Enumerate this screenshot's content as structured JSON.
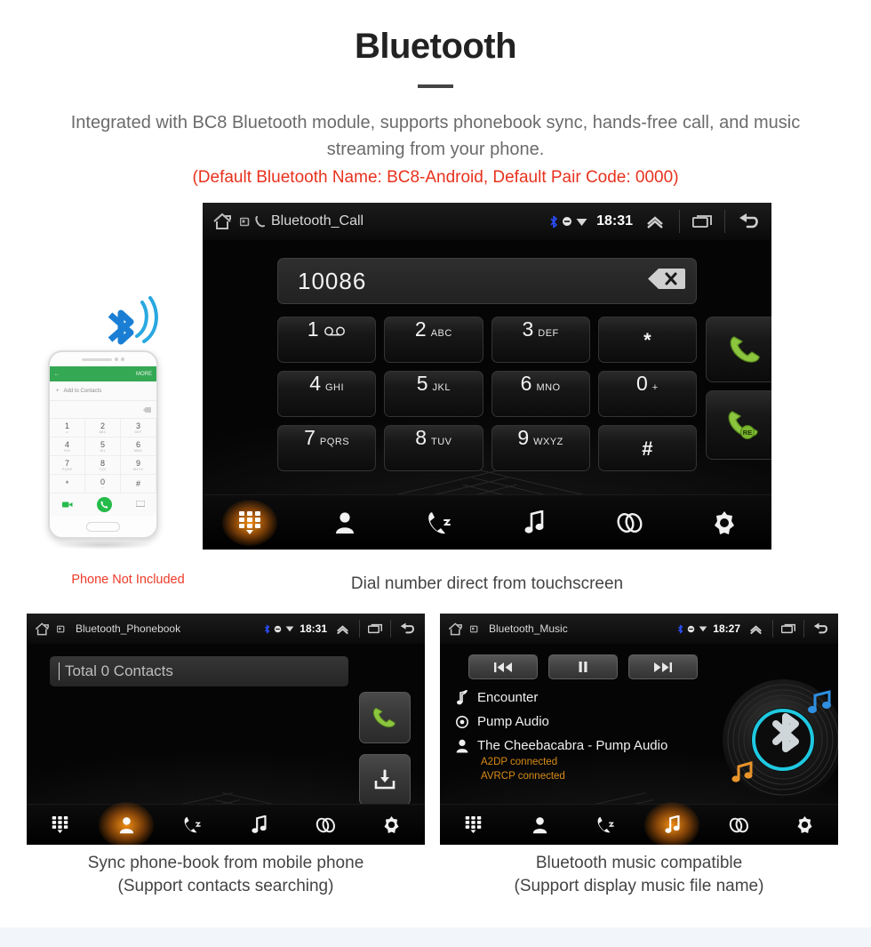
{
  "header": {
    "title": "Bluetooth",
    "subtitle": "Integrated with BC8 Bluetooth module, supports phonebook sync, hands-free call, and music streaming from your phone.",
    "note": "(Default Bluetooth Name: BC8-Android, Default Pair Code: 0000)",
    "note_color": "#e8321e"
  },
  "main_screen": {
    "statusbar": {
      "title": "Bluetooth_Call",
      "time": "18:31",
      "home_icon": "home-icon",
      "window_icon": "window-icon",
      "phone_icon": "phone-handset-icon",
      "bluetooth_icon": "bluetooth-icon",
      "mute_icon": "mute-circle-icon",
      "signal_icon": "signal-icon",
      "expand_icon": "chevron-up-icon",
      "recents_icon": "recents-icon",
      "back_icon": "back-arrow-icon",
      "bluetooth_color": "#2a4df5"
    },
    "dial_value": "10086",
    "backspace_icon": "backspace-icon",
    "keypad": [
      [
        {
          "digit": "1",
          "letters": "∞",
          "voicemail": true
        },
        {
          "digit": "2",
          "letters": "ABC"
        },
        {
          "digit": "3",
          "letters": "DEF"
        },
        {
          "digit": "*",
          "symbol": true
        }
      ],
      [
        {
          "digit": "4",
          "letters": "GHI"
        },
        {
          "digit": "5",
          "letters": "JKL"
        },
        {
          "digit": "6",
          "letters": "MNO"
        },
        {
          "digit": "0",
          "letters": "+"
        }
      ],
      [
        {
          "digit": "7",
          "letters": "PQRS"
        },
        {
          "digit": "8",
          "letters": "TUV"
        },
        {
          "digit": "9",
          "letters": "WXYZ"
        },
        {
          "digit": "#",
          "symbol": true
        }
      ]
    ],
    "call_button_icon": "call-icon",
    "redial_button_icon": "redial-icon",
    "redial_badge": "RE",
    "call_green": "#8cc63f",
    "nav": [
      {
        "name": "keypad",
        "icon": "keypad-icon",
        "active": true
      },
      {
        "name": "contacts",
        "icon": "contacts-icon",
        "active": false
      },
      {
        "name": "call-history",
        "icon": "call-history-icon",
        "active": false
      },
      {
        "name": "music",
        "icon": "music-note-icon",
        "active": false
      },
      {
        "name": "pair",
        "icon": "link-icon",
        "active": false
      },
      {
        "name": "settings",
        "icon": "gear-icon",
        "active": false
      }
    ],
    "caption": "Dial number direct from touchscreen"
  },
  "phonebook_screen": {
    "statusbar": {
      "title": "Bluetooth_Phonebook",
      "time": "18:31"
    },
    "search_value": "Total 0 Contacts",
    "call_button_icon": "call-icon",
    "download_button_icon": "download-sync-icon",
    "nav": [
      {
        "name": "keypad",
        "icon": "keypad-icon",
        "active": false
      },
      {
        "name": "contacts",
        "icon": "contacts-icon",
        "active": true
      },
      {
        "name": "call-history",
        "icon": "call-history-icon",
        "active": false
      },
      {
        "name": "music",
        "icon": "music-note-icon",
        "active": false
      },
      {
        "name": "pair",
        "icon": "link-icon",
        "active": false
      },
      {
        "name": "settings",
        "icon": "gear-icon",
        "active": false
      }
    ],
    "caption_line1": "Sync phone-book from mobile phone",
    "caption_line2": "(Support contacts searching)"
  },
  "music_screen": {
    "statusbar": {
      "title": "Bluetooth_Music",
      "time": "18:27"
    },
    "controls": [
      {
        "name": "previous",
        "icon": "previous-track-icon"
      },
      {
        "name": "pause",
        "icon": "pause-icon"
      },
      {
        "name": "next",
        "icon": "next-track-icon"
      }
    ],
    "track": {
      "title": "Encounter",
      "album": "Pump Audio",
      "artist": "The Cheebacabra - Pump Audio",
      "title_icon": "music-note-icon",
      "album_icon": "disc-icon",
      "artist_icon": "person-icon"
    },
    "status_lines": [
      "A2DP connected",
      "AVRCP connected"
    ],
    "status_color": "#d98b17",
    "album_art_icon": "vinyl-bluetooth-icon",
    "nav": [
      {
        "name": "keypad",
        "icon": "keypad-icon",
        "active": false
      },
      {
        "name": "contacts",
        "icon": "contacts-icon",
        "active": false
      },
      {
        "name": "call-history",
        "icon": "call-history-icon",
        "active": false
      },
      {
        "name": "music",
        "icon": "music-note-icon",
        "active": true
      },
      {
        "name": "pair",
        "icon": "link-icon",
        "active": false
      },
      {
        "name": "settings",
        "icon": "gear-icon",
        "active": false
      }
    ],
    "caption_line1": "Bluetooth music compatible",
    "caption_line2": "(Support display music file name)"
  },
  "phone_mockup": {
    "bluetooth_wave_icon": "bluetooth-wave-icon",
    "back_icon": "back-arrow-icon",
    "more_label": "MORE",
    "add_label": "Add to Contacts",
    "backspace_icon": "backspace-icon",
    "keys": [
      {
        "n": "1",
        "s": "∞"
      },
      {
        "n": "2",
        "s": "ABC"
      },
      {
        "n": "3",
        "s": "DEF"
      },
      {
        "n": "4",
        "s": "GHI"
      },
      {
        "n": "5",
        "s": "JKL"
      },
      {
        "n": "6",
        "s": "MNO"
      },
      {
        "n": "7",
        "s": "PQRS"
      },
      {
        "n": "8",
        "s": "TUV"
      },
      {
        "n": "9",
        "s": "WXYZ"
      },
      {
        "n": "*",
        "s": ""
      },
      {
        "n": "0",
        "s": "+"
      },
      {
        "n": "#",
        "s": ""
      }
    ],
    "video_call_icon": "video-call-icon",
    "call_icon": "call-icon",
    "keyboard_icon": "keyboard-icon",
    "not_included_label": "Phone Not Included",
    "not_included_color": "#ee3b28"
  }
}
